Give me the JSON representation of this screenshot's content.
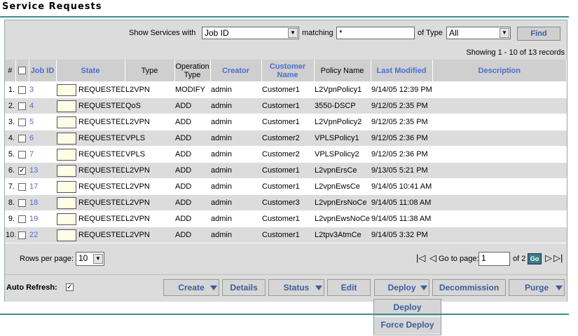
{
  "page_title": "Service Requests",
  "filter": {
    "show_label": "Show Services with",
    "field_value": "Job ID",
    "matching_label": "matching",
    "matching_value": "*",
    "type_label": "of Type",
    "type_value": "All",
    "find_label": "Find"
  },
  "showing_text": "Showing 1 - 10 of 13 records",
  "columns": {
    "num": "#",
    "job_id": "Job ID",
    "state": "State",
    "type": "Type",
    "operation_type": "Operation Type",
    "creator": "Creator",
    "customer_name": "Customer Name",
    "policy_name": "Policy Name",
    "last_modified": "Last Modified",
    "description": "Description"
  },
  "rows": [
    {
      "num": "1.",
      "checked": false,
      "job_id": "3",
      "state": "REQUESTED",
      "type": "L2VPN",
      "op": "MODIFY",
      "creator": "admin",
      "customer": "Customer1",
      "policy": "L2VpnPolicy1",
      "modified": "9/14/05 12:39 PM",
      "description": ""
    },
    {
      "num": "2.",
      "checked": false,
      "job_id": "4",
      "state": "REQUESTED",
      "type": "QoS",
      "op": "ADD",
      "creator": "admin",
      "customer": "Customer1",
      "policy": "3550-DSCP",
      "modified": "9/12/05 2:35 PM",
      "description": ""
    },
    {
      "num": "3.",
      "checked": false,
      "job_id": "5",
      "state": "REQUESTED",
      "type": "L2VPN",
      "op": "ADD",
      "creator": "admin",
      "customer": "Customer1",
      "policy": "L2VpnPolicy2",
      "modified": "9/12/05 2:35 PM",
      "description": ""
    },
    {
      "num": "4.",
      "checked": false,
      "job_id": "6",
      "state": "REQUESTED",
      "type": "VPLS",
      "op": "ADD",
      "creator": "admin",
      "customer": "Customer2",
      "policy": "VPLSPolicy1",
      "modified": "9/12/05 2:36 PM",
      "description": ""
    },
    {
      "num": "5.",
      "checked": false,
      "job_id": "7",
      "state": "REQUESTED",
      "type": "VPLS",
      "op": "ADD",
      "creator": "admin",
      "customer": "Customer2",
      "policy": "VPLSPolicy2",
      "modified": "9/12/05 2:36 PM",
      "description": ""
    },
    {
      "num": "6.",
      "checked": true,
      "job_id": "13",
      "state": "REQUESTED",
      "type": "L2VPN",
      "op": "ADD",
      "creator": "admin",
      "customer": "Customer1",
      "policy": "L2vpnErsCe",
      "modified": "9/13/05 5:21 PM",
      "description": ""
    },
    {
      "num": "7.",
      "checked": false,
      "job_id": "17",
      "state": "REQUESTED",
      "type": "L2VPN",
      "op": "ADD",
      "creator": "admin",
      "customer": "Customer1",
      "policy": "L2vpnEwsCe",
      "modified": "9/14/05 10:41 AM",
      "description": ""
    },
    {
      "num": "8.",
      "checked": false,
      "job_id": "18",
      "state": "REQUESTED",
      "type": "L2VPN",
      "op": "ADD",
      "creator": "admin",
      "customer": "Customer3",
      "policy": "L2vpnErsNoCe",
      "modified": "9/14/05 11:08 AM",
      "description": ""
    },
    {
      "num": "9.",
      "checked": false,
      "job_id": "19",
      "state": "REQUESTED",
      "type": "L2VPN",
      "op": "ADD",
      "creator": "admin",
      "customer": "Customer1",
      "policy": "L2vpnEwsNoCe",
      "modified": "9/14/05 11:38 AM",
      "description": ""
    },
    {
      "num": "10.",
      "checked": false,
      "job_id": "22",
      "state": "REQUESTED",
      "type": "L2VPN",
      "op": "ADD",
      "creator": "admin",
      "customer": "Customer1",
      "policy": "L2tpv3AtmCe",
      "modified": "9/14/05 3:32 PM",
      "description": ""
    }
  ],
  "pager": {
    "rows_per_page_label": "Rows per page:",
    "rows_per_page_value": "10",
    "goto_label": "Go to page:",
    "goto_value": "1",
    "of_text": "of 2",
    "go_label": "Go"
  },
  "auto_refresh": {
    "label": "Auto Refresh:",
    "checked": true
  },
  "actions": {
    "create": "Create",
    "details": "Details",
    "status": "Status",
    "edit": "Edit",
    "deploy": "Deploy",
    "decommission": "Decommission",
    "purge": "Purge"
  },
  "deploy_menu": [
    "Deploy",
    "Force Deploy"
  ],
  "figure_id": "138522"
}
